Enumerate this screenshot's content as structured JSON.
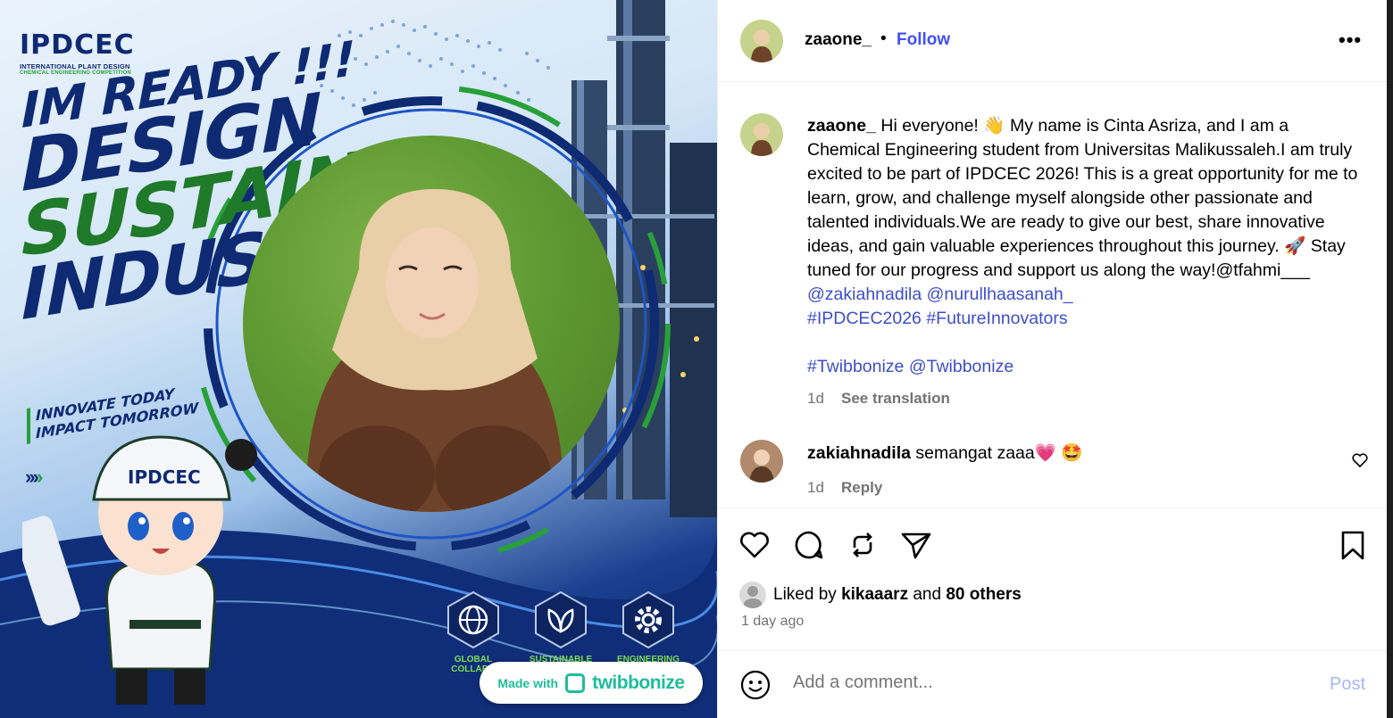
{
  "poster": {
    "brand": {
      "name_part1": "IPD",
      "name_part2": "CEC",
      "subtitle1": "INTERNATIONAL PLANT DESIGN",
      "subtitle2": "CHEMICAL ENGINEERING COMPETITION"
    },
    "headline": [
      "IM READY !!!",
      "DESIGN",
      "SUSTAIN",
      "INDUSTRY"
    ],
    "tagline": [
      "INNOVATE TODAY",
      "IMPACT TOMORROW"
    ],
    "features": [
      {
        "label": "GLOBAL\nCOLLABO",
        "icon": "globe-icon"
      },
      {
        "label": "SUSTAINABLE",
        "icon": "leaf-icon"
      },
      {
        "label": "ENGINEERING",
        "icon": "gear-icon"
      }
    ],
    "made_with": {
      "label": "Made with",
      "brand": "twibbonize"
    },
    "mascot_badge": "IPDCEC"
  },
  "post": {
    "header": {
      "username": "zaaone_",
      "separator": "•",
      "follow_label": "Follow",
      "more_label": "•••"
    },
    "caption": {
      "username": "zaaone_",
      "text": " Hi everyone! 👋 My name is Cinta Asriza, and I am a Chemical Engineering student from Universitas Malikussaleh.I am truly excited to be part of IPDCEC 2026! This is a great opportunity for me to learn, grow, and challenge myself alongside other passionate and talented individuals.We are ready to give our best, share innovative ideas, and gain valuable experiences throughout this journey. 🚀 Stay tuned for our progress and support us along the way!@tfahmi___ ",
      "mentions": "@zakiahnadila @nurullhaasanah_",
      "hashtags": "#IPDCEC2026 #FutureInnovators",
      "hashtags2": "#Twibbonize @Twibbonize",
      "time": "1d",
      "see_translation": "See translation"
    },
    "comments": [
      {
        "username": "zakiahnadila",
        "text": "semangat zaaa💗 🤩",
        "time": "1d",
        "reply_label": "Reply"
      }
    ],
    "likes": {
      "prefix": "Liked by",
      "user": "kikaaarz",
      "middle": "and",
      "count": "80 others"
    },
    "timestamp": "1 day ago",
    "comment_input": {
      "placeholder": "Add a comment...",
      "post_label": "Post"
    }
  },
  "colors": {
    "follow": "#4150f7",
    "link": "#3d4ec9",
    "muted": "#737373",
    "post_disabled": "#a7b6f7",
    "brand_navy": "#0e2a73",
    "brand_green": "#27a03a"
  }
}
